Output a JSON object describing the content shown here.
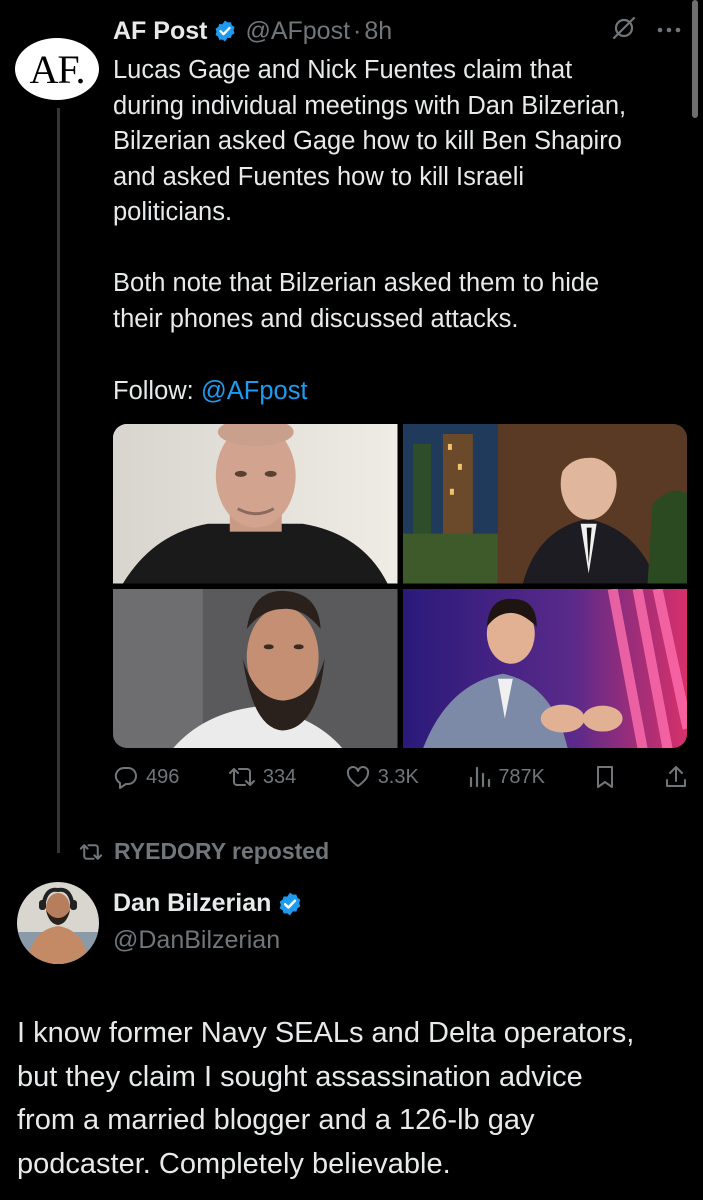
{
  "af_post": {
    "avatar_text": "AF.",
    "name": "AF Post",
    "handle": "@AFpost",
    "separator": "·",
    "time": "8h",
    "body": "Lucas Gage and Nick Fuentes claim that\nduring individual meetings with Dan Bilzerian,\nBilzerian asked Gage how to kill Ben Shapiro\nand asked Fuentes how to kill Israeli\npoliticians.\n\nBoth note that Bilzerian asked them to hide\ntheir phones and discussed attacks.",
    "follow_prefix": "Follow: ",
    "follow_link": "@AFpost",
    "media": [
      {
        "desc": "man-in-black-tshirt"
      },
      {
        "desc": "man-in-suit-city-backdrop"
      },
      {
        "desc": "bearded-man"
      },
      {
        "desc": "speaker-on-stage"
      }
    ],
    "stats": {
      "replies": "496",
      "reposts": "334",
      "likes": "3.3K",
      "views": "787K"
    }
  },
  "repost": {
    "label": "RYEDORY reposted"
  },
  "dan_post": {
    "name": "Dan Bilzerian",
    "handle": "@DanBilzerian",
    "body": "I know former Navy SEALs and Delta operators,\nbut they claim I sought assassination advice\nfrom a married blogger and a 126-lb gay\npodcaster. Completely believable."
  },
  "colors": {
    "background": "#000000",
    "text": "#e7e9ea",
    "muted": "#71767b",
    "accent": "#1d9bf0"
  }
}
